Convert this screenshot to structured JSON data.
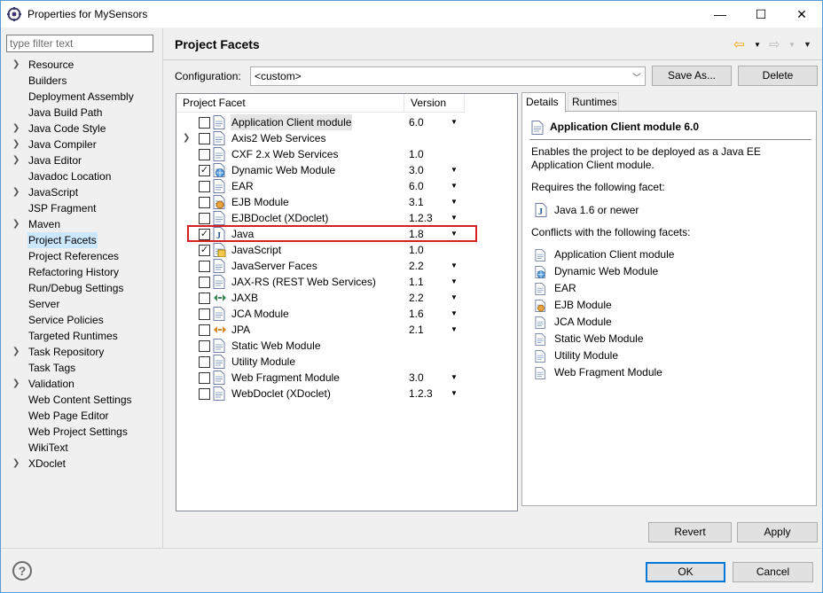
{
  "window": {
    "title": "Properties for MySensors",
    "minimize": "—",
    "maximize": "☐",
    "close": "✕"
  },
  "filter": {
    "placeholder": "type filter text"
  },
  "nav": {
    "items": [
      {
        "label": "Resource",
        "expandable": true
      },
      {
        "label": "Builders",
        "expandable": false
      },
      {
        "label": "Deployment Assembly",
        "expandable": false
      },
      {
        "label": "Java Build Path",
        "expandable": false
      },
      {
        "label": "Java Code Style",
        "expandable": true
      },
      {
        "label": "Java Compiler",
        "expandable": true
      },
      {
        "label": "Java Editor",
        "expandable": true
      },
      {
        "label": "Javadoc Location",
        "expandable": false
      },
      {
        "label": "JavaScript",
        "expandable": true
      },
      {
        "label": "JSP Fragment",
        "expandable": false
      },
      {
        "label": "Maven",
        "expandable": true
      },
      {
        "label": "Project Facets",
        "expandable": false,
        "selected": true
      },
      {
        "label": "Project References",
        "expandable": false
      },
      {
        "label": "Refactoring History",
        "expandable": false
      },
      {
        "label": "Run/Debug Settings",
        "expandable": false
      },
      {
        "label": "Server",
        "expandable": false
      },
      {
        "label": "Service Policies",
        "expandable": false
      },
      {
        "label": "Targeted Runtimes",
        "expandable": false
      },
      {
        "label": "Task Repository",
        "expandable": true
      },
      {
        "label": "Task Tags",
        "expandable": false
      },
      {
        "label": "Validation",
        "expandable": true
      },
      {
        "label": "Web Content Settings",
        "expandable": false
      },
      {
        "label": "Web Page Editor",
        "expandable": false
      },
      {
        "label": "Web Project Settings",
        "expandable": false
      },
      {
        "label": "WikiText",
        "expandable": false
      },
      {
        "label": "XDoclet",
        "expandable": true
      }
    ]
  },
  "page": {
    "title": "Project Facets"
  },
  "config": {
    "label": "Configuration:",
    "value": "<custom>",
    "save_as": "Save As...",
    "delete": "Delete"
  },
  "table": {
    "col_facet": "Project Facet",
    "col_version": "Version",
    "rows": [
      {
        "name": "Application Client module",
        "version": "6.0",
        "checked": false,
        "dropdown": true,
        "icon": "page-icon",
        "selected": true
      },
      {
        "name": "Axis2 Web Services",
        "version": "",
        "checked": false,
        "dropdown": false,
        "icon": "page-icon",
        "expandable": true
      },
      {
        "name": "CXF 2.x Web Services",
        "version": "1.0",
        "checked": false,
        "dropdown": false,
        "icon": "page-icon"
      },
      {
        "name": "Dynamic Web Module",
        "version": "3.0",
        "checked": true,
        "dropdown": true,
        "icon": "web-module-icon"
      },
      {
        "name": "EAR",
        "version": "6.0",
        "checked": false,
        "dropdown": true,
        "icon": "page-icon"
      },
      {
        "name": "EJB Module",
        "version": "3.1",
        "checked": false,
        "dropdown": true,
        "icon": "ejb-icon"
      },
      {
        "name": "EJBDoclet (XDoclet)",
        "version": "1.2.3",
        "checked": false,
        "dropdown": true,
        "icon": "page-icon"
      },
      {
        "name": "Java",
        "version": "1.8",
        "checked": true,
        "dropdown": true,
        "icon": "java-icon"
      },
      {
        "name": "JavaScript",
        "version": "1.0",
        "checked": true,
        "dropdown": false,
        "icon": "javascript-icon"
      },
      {
        "name": "JavaServer Faces",
        "version": "2.2",
        "checked": false,
        "dropdown": true,
        "icon": "page-icon"
      },
      {
        "name": "JAX-RS (REST Web Services)",
        "version": "1.1",
        "checked": false,
        "dropdown": true,
        "icon": "page-icon"
      },
      {
        "name": "JAXB",
        "version": "2.2",
        "checked": false,
        "dropdown": true,
        "icon": "jaxb-icon"
      },
      {
        "name": "JCA Module",
        "version": "1.6",
        "checked": false,
        "dropdown": true,
        "icon": "page-icon"
      },
      {
        "name": "JPA",
        "version": "2.1",
        "checked": false,
        "dropdown": true,
        "icon": "jpa-icon"
      },
      {
        "name": "Static Web Module",
        "version": "",
        "checked": false,
        "dropdown": false,
        "icon": "page-icon"
      },
      {
        "name": "Utility Module",
        "version": "",
        "checked": false,
        "dropdown": false,
        "icon": "page-icon"
      },
      {
        "name": "Web Fragment Module",
        "version": "3.0",
        "checked": false,
        "dropdown": true,
        "icon": "page-icon"
      },
      {
        "name": "WebDoclet (XDoclet)",
        "version": "1.2.3",
        "checked": false,
        "dropdown": true,
        "icon": "page-icon"
      }
    ]
  },
  "details": {
    "tab_details": "Details",
    "tab_runtimes": "Runtimes",
    "title": "Application Client module 6.0",
    "description": "Enables the project to be deployed as a Java EE Application Client module.",
    "requires_label": "Requires the following facet:",
    "requires": [
      "Java 1.6 or newer"
    ],
    "conflicts_label": "Conflicts with the following facets:",
    "conflicts": [
      "Application Client module",
      "Dynamic Web Module",
      "EAR",
      "EJB Module",
      "JCA Module",
      "Static Web Module",
      "Utility Module",
      "Web Fragment Module"
    ]
  },
  "buttons": {
    "revert": "Revert",
    "apply": "Apply",
    "ok": "OK",
    "cancel": "Cancel"
  },
  "help": "?",
  "colors": {
    "selection": "#cce8ff",
    "highlight_box": "#d42020",
    "back_arrow": "#e8a200"
  }
}
